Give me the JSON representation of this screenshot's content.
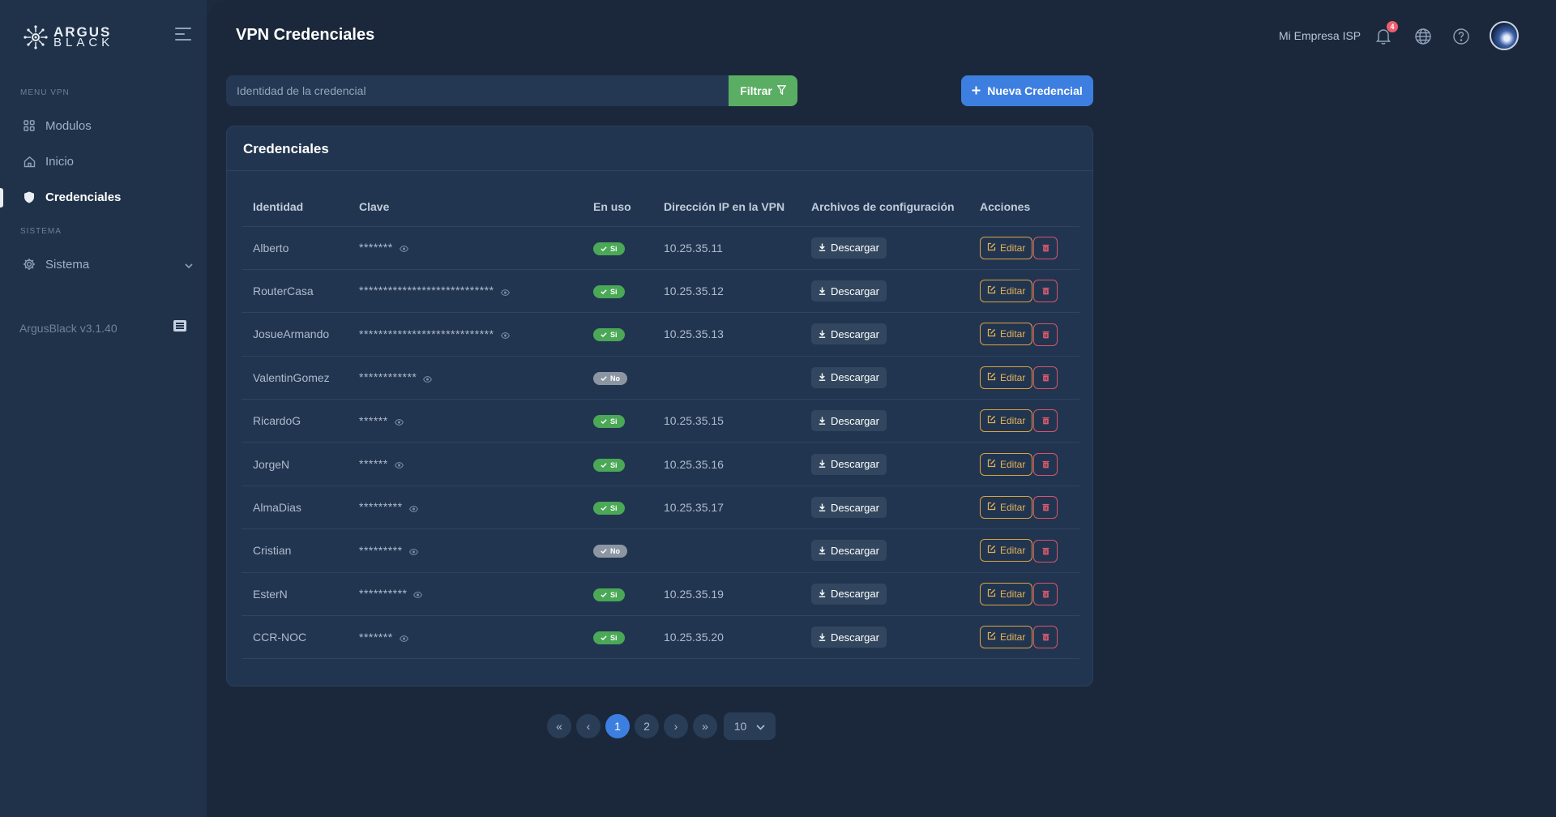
{
  "brand": {
    "line1": "ARGUS",
    "line2": "BLACK"
  },
  "sidebar": {
    "section_vpn": "MENU VPN",
    "section_system": "SISTEMA",
    "items": [
      {
        "label": "Modulos",
        "icon": "grid-icon"
      },
      {
        "label": "Inicio",
        "icon": "home-icon"
      },
      {
        "label": "Credenciales",
        "icon": "shield-icon",
        "active": true
      },
      {
        "label": "Sistema",
        "icon": "gear-icon"
      }
    ],
    "version": "ArgusBlack v3.1.40"
  },
  "header": {
    "title": "VPN Credenciales",
    "company": "Mi Empresa ISP",
    "notifications": "4"
  },
  "toolbar": {
    "search_placeholder": "Identidad de la credencial",
    "filter_label": "Filtrar",
    "new_label": "Nueva Credencial"
  },
  "card": {
    "title": "Credenciales",
    "columns": [
      "Identidad",
      "Clave",
      "En uso",
      "Dirección IP en la VPN",
      "Archivos de configuración",
      "Acciones"
    ],
    "download_label": "Descargar",
    "edit_label": "Editar",
    "rows": [
      {
        "identity": "Alberto",
        "password": "*******",
        "in_use": "Si",
        "ip": "10.25.35.11"
      },
      {
        "identity": "RouterCasa",
        "password": "****************************",
        "in_use": "Si",
        "ip": "10.25.35.12"
      },
      {
        "identity": "JosueArmando",
        "password": "****************************",
        "in_use": "Si",
        "ip": "10.25.35.13"
      },
      {
        "identity": "ValentinGomez",
        "password": "************",
        "in_use": "No",
        "ip": ""
      },
      {
        "identity": "RicardoG",
        "password": "******",
        "in_use": "Si",
        "ip": "10.25.35.15"
      },
      {
        "identity": "JorgeN",
        "password": "******",
        "in_use": "Si",
        "ip": "10.25.35.16"
      },
      {
        "identity": "AlmaDias",
        "password": "*********",
        "in_use": "Si",
        "ip": "10.25.35.17"
      },
      {
        "identity": "Cristian",
        "password": "*********",
        "in_use": "No",
        "ip": ""
      },
      {
        "identity": "EsterN",
        "password": "**********",
        "in_use": "Si",
        "ip": "10.25.35.19"
      },
      {
        "identity": "CCR-NOC",
        "password": "*******",
        "in_use": "Si",
        "ip": "10.25.35.20"
      }
    ]
  },
  "pagination": {
    "first": "«",
    "prev": "‹",
    "pages": [
      "1",
      "2"
    ],
    "current": "1",
    "next": "›",
    "last": "»",
    "per_page": "10"
  },
  "colors": {
    "accent": "#3d7fe0",
    "success": "#5aae63",
    "warning": "#d9a441",
    "danger": "#d9546a"
  }
}
